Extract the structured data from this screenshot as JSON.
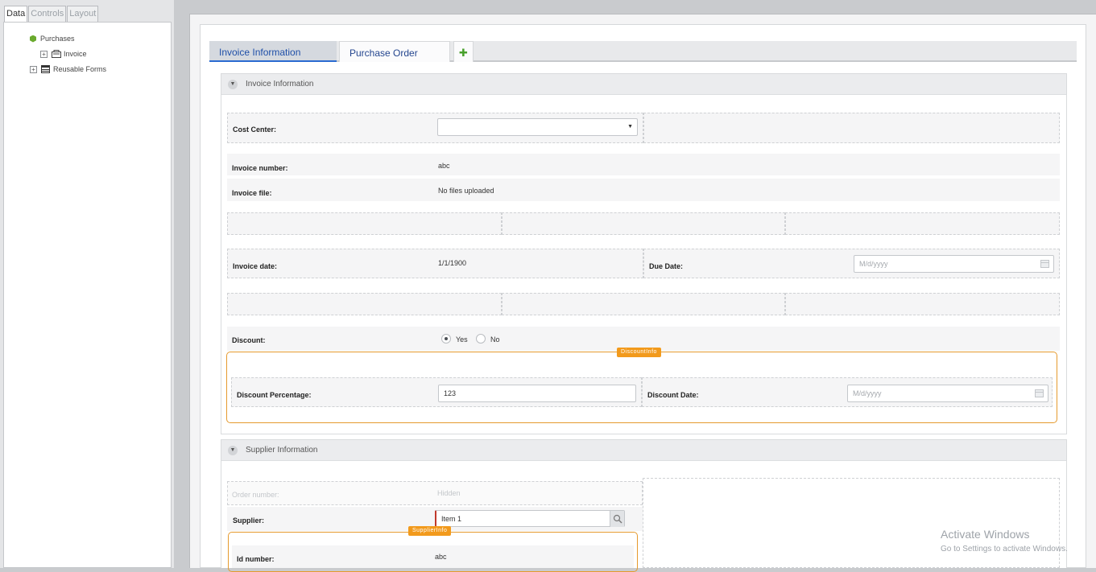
{
  "left_panel": {
    "tabs": [
      {
        "label": "Data"
      },
      {
        "label": "Controls"
      },
      {
        "label": "Layout"
      }
    ],
    "tree": {
      "root": "Purchases",
      "child": "Invoice",
      "reusable": "Reusable Forms"
    }
  },
  "form_tabs": [
    {
      "label": "Invoice Information"
    },
    {
      "label": "Purchase Order"
    }
  ],
  "invoice_section": {
    "title": "Invoice Information",
    "cost_center_label": "Cost Center:",
    "invoice_number_label": "Invoice number:",
    "invoice_number_value": "abc",
    "invoice_file_label": "Invoice file:",
    "invoice_file_value": "No files uploaded",
    "invoice_date_label": "Invoice date:",
    "invoice_date_value": "1/1/1900",
    "due_date_label": "Due Date:",
    "due_date_placeholder": "M/d/yyyy",
    "discount_label": "Discount:",
    "discount_yes": "Yes",
    "discount_no": "No",
    "discount_group_tag": "DiscountInfo",
    "discount_percentage_label": "Discount Percentage:",
    "discount_percentage_value": "123",
    "discount_date_label": "Discount Date:",
    "discount_date_placeholder": "M/d/yyyy"
  },
  "supplier_section": {
    "title": "Supplier Information",
    "order_number_label": "Order number:",
    "order_number_value": "Hidden",
    "supplier_label": "Supplier:",
    "supplier_value": "Item 1",
    "supplier_group_tag": "SupplierInfo",
    "id_number_label": "Id number:",
    "id_number_value": "abc"
  },
  "watermark": {
    "title": "Activate Windows",
    "subtitle": "Go to Settings to activate Windows."
  },
  "colors": {
    "accent_orange": "#f29a1c",
    "tab_blue": "#1f4fa8",
    "tree_green": "#6aaa2e"
  }
}
